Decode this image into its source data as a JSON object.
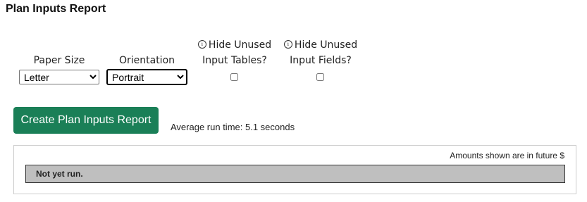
{
  "page": {
    "title": "Plan Inputs Report"
  },
  "options": {
    "paper_size": {
      "label": "Paper Size",
      "value": "Letter",
      "options": [
        "Letter"
      ]
    },
    "orientation": {
      "label": "Orientation",
      "value": "Portrait",
      "options": [
        "Portrait"
      ]
    },
    "hide_unused_tables": {
      "label_line1": "Hide Unused",
      "label_line2": "Input Tables?",
      "checked": false,
      "info_icon": "info-icon"
    },
    "hide_unused_fields": {
      "label_line1": "Hide Unused",
      "label_line2": "Input Fields?",
      "checked": false,
      "info_icon": "info-icon"
    }
  },
  "actions": {
    "create_label": "Create Plan Inputs Report",
    "run_time_text": "Average run time: 5.1 seconds",
    "button_color": "#1a7f57"
  },
  "results": {
    "currency_note": "Amounts shown are in future $",
    "status": "Not yet run."
  }
}
